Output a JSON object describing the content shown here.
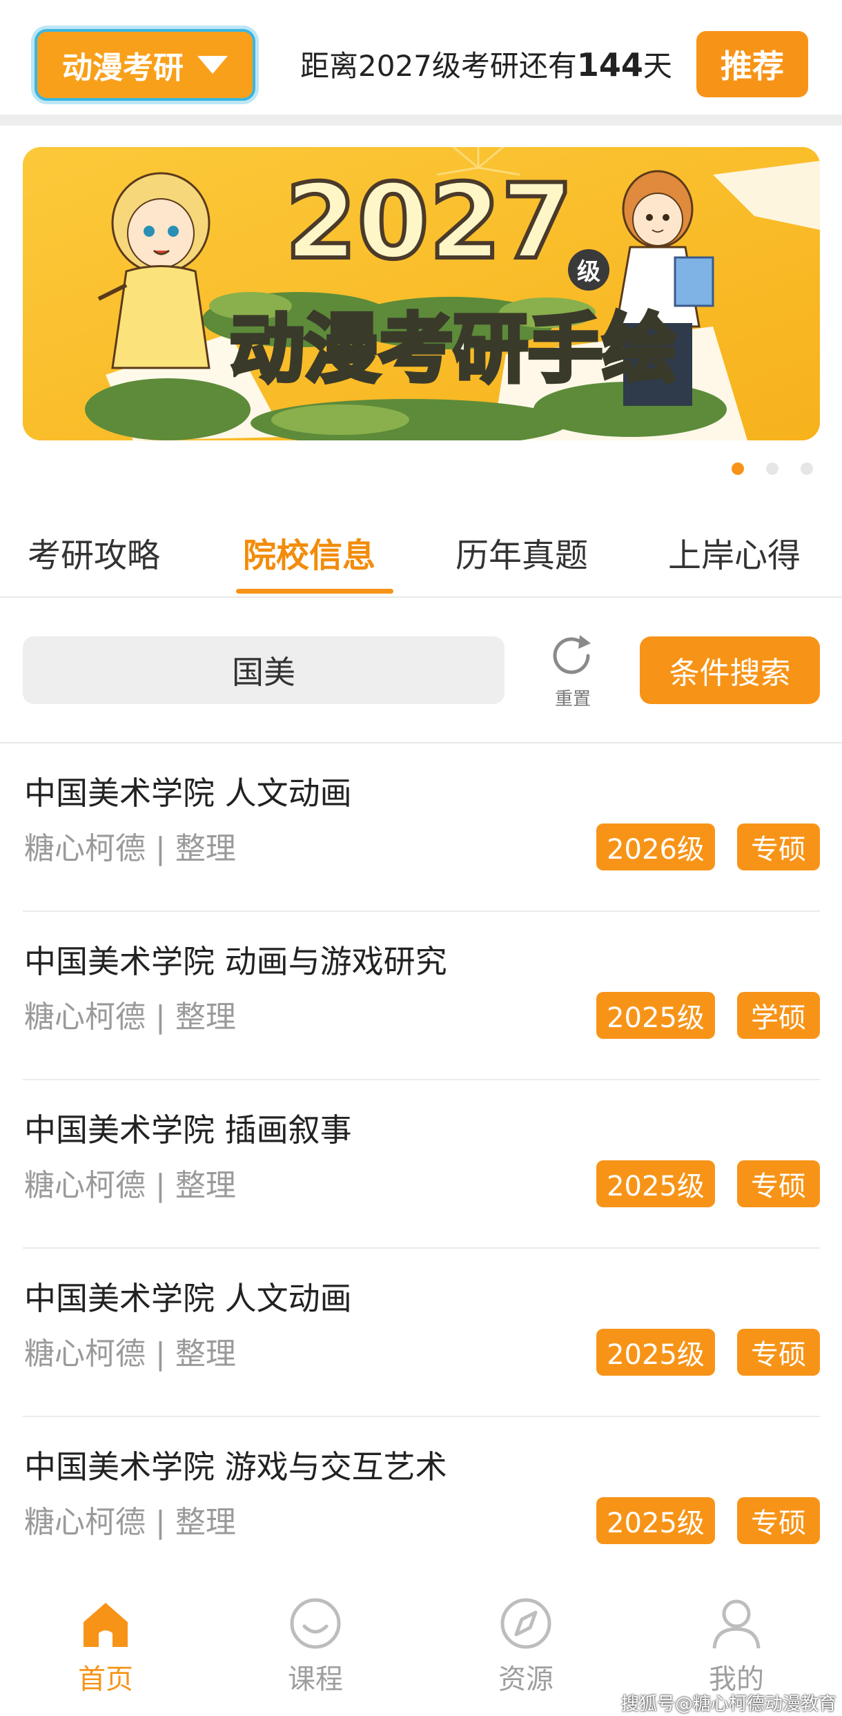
{
  "header": {
    "app_switch_label": "动漫考研",
    "countdown_prefix": "距离2027级考研还有",
    "countdown_days": "144",
    "countdown_suffix": "天",
    "recommend_label": "推荐"
  },
  "banner": {
    "title_year": "2027",
    "title_grade": "级",
    "title_main": "动漫考研手绘",
    "active_slide": 1,
    "slide_count": 3
  },
  "tabs": [
    {
      "label": "考研攻略",
      "active": false
    },
    {
      "label": "院校信息",
      "active": true
    },
    {
      "label": "历年真题",
      "active": false
    },
    {
      "label": "上岸心得",
      "active": false
    }
  ],
  "search": {
    "value": "国美",
    "reset_label": "重置",
    "button_label": "条件搜索"
  },
  "list": [
    {
      "title": "中国美术学院 人文动画",
      "author": "糖心柯德",
      "separator": "|",
      "note": "整理",
      "year": "2026级",
      "degree": "专硕"
    },
    {
      "title": "中国美术学院 动画与游戏研究",
      "author": "糖心柯德",
      "separator": "|",
      "note": "整理",
      "year": "2025级",
      "degree": "学硕"
    },
    {
      "title": "中国美术学院 插画叙事",
      "author": "糖心柯德",
      "separator": "|",
      "note": "整理",
      "year": "2025级",
      "degree": "专硕"
    },
    {
      "title": "中国美术学院 人文动画",
      "author": "糖心柯德",
      "separator": "|",
      "note": "整理",
      "year": "2025级",
      "degree": "专硕"
    },
    {
      "title": "中国美术学院 游戏与交互艺术",
      "author": "糖心柯德",
      "separator": "|",
      "note": "整理",
      "year": "2025级",
      "degree": "专硕"
    }
  ],
  "bottom_nav": [
    {
      "label": "首页",
      "icon": "home-icon",
      "active": true
    },
    {
      "label": "课程",
      "icon": "smile-icon",
      "active": false
    },
    {
      "label": "资源",
      "icon": "compass-icon",
      "active": false
    },
    {
      "label": "我的",
      "icon": "user-icon",
      "active": false
    }
  ],
  "watermark": "搜狐号@糖心柯德动漫教育",
  "colors": {
    "accent": "#f79418",
    "active_tab_text": "#f28c0a",
    "banner_bg": "#fbbf26",
    "switch_border": "#3bb6e0"
  }
}
